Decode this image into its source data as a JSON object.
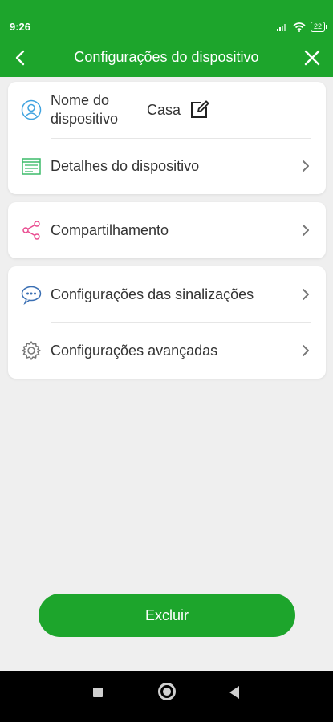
{
  "status": {
    "time": "9:26",
    "battery": "22"
  },
  "header": {
    "title": "Configurações do dispositivo"
  },
  "cards": {
    "device": {
      "name_label": "Nome do dispositivo",
      "name_value": "Casa",
      "details_label": "Detalhes do dispositivo"
    },
    "sharing": {
      "label": "Compartilhamento"
    },
    "settings": {
      "signals_label": "Configurações das sinalizações",
      "advanced_label": "Configurações avançadas"
    }
  },
  "actions": {
    "delete_label": "Excluir"
  },
  "colors": {
    "brand": "#1da52c",
    "background": "#efefef"
  },
  "icons": {
    "device_name": "person-icon",
    "device_details": "details-list-icon",
    "sharing": "share-icon",
    "signals": "chat-bubble-icon",
    "advanced": "gear-icon"
  }
}
